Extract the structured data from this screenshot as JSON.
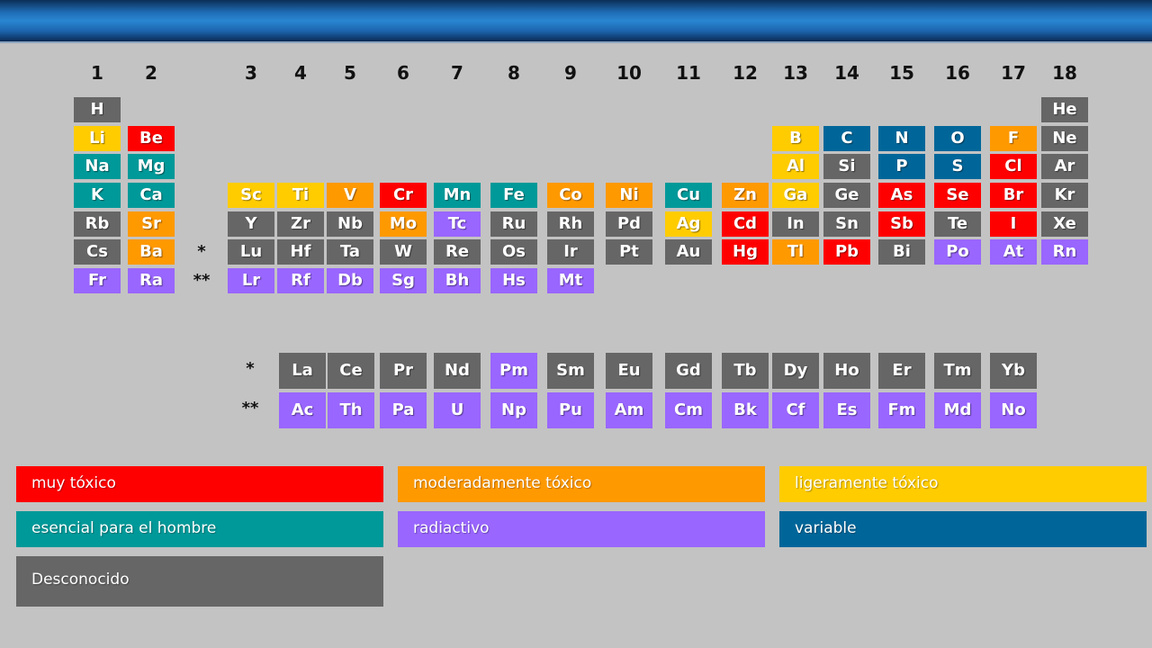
{
  "colors": {
    "very_toxic": "#ff0000",
    "moderately_toxic": "#ff9900",
    "slightly_toxic": "#ffcc00",
    "essential": "#009999",
    "radioactive": "#9966ff",
    "variable": "#006699",
    "unknown": "#666666"
  },
  "groups": [
    "1",
    "2",
    "3",
    "4",
    "5",
    "6",
    "7",
    "8",
    "9",
    "10",
    "11",
    "12",
    "13",
    "14",
    "15",
    "16",
    "17",
    "18"
  ],
  "markers": {
    "lanthanide": "*",
    "actinide": "**"
  },
  "elements": [
    {
      "symbol": "H",
      "cat": "unknown",
      "group": 1,
      "period": 1
    },
    {
      "symbol": "He",
      "cat": "unknown",
      "group": 18,
      "period": 1
    },
    {
      "symbol": "Li",
      "cat": "slightly_toxic",
      "group": 1,
      "period": 2
    },
    {
      "symbol": "Be",
      "cat": "very_toxic",
      "group": 2,
      "period": 2
    },
    {
      "symbol": "B",
      "cat": "slightly_toxic",
      "group": 13,
      "period": 2
    },
    {
      "symbol": "C",
      "cat": "variable",
      "group": 14,
      "period": 2
    },
    {
      "symbol": "N",
      "cat": "variable",
      "group": 15,
      "period": 2
    },
    {
      "symbol": "O",
      "cat": "variable",
      "group": 16,
      "period": 2
    },
    {
      "symbol": "F",
      "cat": "moderately_toxic",
      "group": 17,
      "period": 2
    },
    {
      "symbol": "Ne",
      "cat": "unknown",
      "group": 18,
      "period": 2
    },
    {
      "symbol": "Na",
      "cat": "essential",
      "group": 1,
      "period": 3
    },
    {
      "symbol": "Mg",
      "cat": "essential",
      "group": 2,
      "period": 3
    },
    {
      "symbol": "Al",
      "cat": "slightly_toxic",
      "group": 13,
      "period": 3
    },
    {
      "symbol": "Si",
      "cat": "unknown",
      "group": 14,
      "period": 3
    },
    {
      "symbol": "P",
      "cat": "variable",
      "group": 15,
      "period": 3
    },
    {
      "symbol": "S",
      "cat": "variable",
      "group": 16,
      "period": 3
    },
    {
      "symbol": "Cl",
      "cat": "very_toxic",
      "group": 17,
      "period": 3
    },
    {
      "symbol": "Ar",
      "cat": "unknown",
      "group": 18,
      "period": 3
    },
    {
      "symbol": "K",
      "cat": "essential",
      "group": 1,
      "period": 4
    },
    {
      "symbol": "Ca",
      "cat": "essential",
      "group": 2,
      "period": 4
    },
    {
      "symbol": "Sc",
      "cat": "slightly_toxic",
      "group": 3,
      "period": 4
    },
    {
      "symbol": "Ti",
      "cat": "slightly_toxic",
      "group": 4,
      "period": 4
    },
    {
      "symbol": "V",
      "cat": "moderately_toxic",
      "group": 5,
      "period": 4
    },
    {
      "symbol": "Cr",
      "cat": "very_toxic",
      "group": 6,
      "period": 4
    },
    {
      "symbol": "Mn",
      "cat": "essential",
      "group": 7,
      "period": 4
    },
    {
      "symbol": "Fe",
      "cat": "essential",
      "group": 8,
      "period": 4
    },
    {
      "symbol": "Co",
      "cat": "moderately_toxic",
      "group": 9,
      "period": 4
    },
    {
      "symbol": "Ni",
      "cat": "moderately_toxic",
      "group": 10,
      "period": 4
    },
    {
      "symbol": "Cu",
      "cat": "essential",
      "group": 11,
      "period": 4
    },
    {
      "symbol": "Zn",
      "cat": "moderately_toxic",
      "group": 12,
      "period": 4
    },
    {
      "symbol": "Ga",
      "cat": "slightly_toxic",
      "group": 13,
      "period": 4
    },
    {
      "symbol": "Ge",
      "cat": "unknown",
      "group": 14,
      "period": 4
    },
    {
      "symbol": "As",
      "cat": "very_toxic",
      "group": 15,
      "period": 4
    },
    {
      "symbol": "Se",
      "cat": "very_toxic",
      "group": 16,
      "period": 4
    },
    {
      "symbol": "Br",
      "cat": "very_toxic",
      "group": 17,
      "period": 4
    },
    {
      "symbol": "Kr",
      "cat": "unknown",
      "group": 18,
      "period": 4
    },
    {
      "symbol": "Rb",
      "cat": "unknown",
      "group": 1,
      "period": 5
    },
    {
      "symbol": "Sr",
      "cat": "moderately_toxic",
      "group": 2,
      "period": 5
    },
    {
      "symbol": "Y",
      "cat": "unknown",
      "group": 3,
      "period": 5
    },
    {
      "symbol": "Zr",
      "cat": "unknown",
      "group": 4,
      "period": 5
    },
    {
      "symbol": "Nb",
      "cat": "unknown",
      "group": 5,
      "period": 5
    },
    {
      "symbol": "Mo",
      "cat": "moderately_toxic",
      "group": 6,
      "period": 5
    },
    {
      "symbol": "Tc",
      "cat": "radioactive",
      "group": 7,
      "period": 5
    },
    {
      "symbol": "Ru",
      "cat": "unknown",
      "group": 8,
      "period": 5
    },
    {
      "symbol": "Rh",
      "cat": "unknown",
      "group": 9,
      "period": 5
    },
    {
      "symbol": "Pd",
      "cat": "unknown",
      "group": 10,
      "period": 5
    },
    {
      "symbol": "Ag",
      "cat": "slightly_toxic",
      "group": 11,
      "period": 5
    },
    {
      "symbol": "Cd",
      "cat": "very_toxic",
      "group": 12,
      "period": 5
    },
    {
      "symbol": "In",
      "cat": "unknown",
      "group": 13,
      "period": 5
    },
    {
      "symbol": "Sn",
      "cat": "unknown",
      "group": 14,
      "period": 5
    },
    {
      "symbol": "Sb",
      "cat": "very_toxic",
      "group": 15,
      "period": 5
    },
    {
      "symbol": "Te",
      "cat": "unknown",
      "group": 16,
      "period": 5
    },
    {
      "symbol": "I",
      "cat": "very_toxic",
      "group": 17,
      "period": 5
    },
    {
      "symbol": "Xe",
      "cat": "unknown",
      "group": 18,
      "period": 5
    },
    {
      "symbol": "Cs",
      "cat": "unknown",
      "group": 1,
      "period": 6
    },
    {
      "symbol": "Ba",
      "cat": "moderately_toxic",
      "group": 2,
      "period": 6
    },
    {
      "symbol": "Lu",
      "cat": "unknown",
      "group": 3,
      "period": 6
    },
    {
      "symbol": "Hf",
      "cat": "unknown",
      "group": 4,
      "period": 6
    },
    {
      "symbol": "Ta",
      "cat": "unknown",
      "group": 5,
      "period": 6
    },
    {
      "symbol": "W",
      "cat": "unknown",
      "group": 6,
      "period": 6
    },
    {
      "symbol": "Re",
      "cat": "unknown",
      "group": 7,
      "period": 6
    },
    {
      "symbol": "Os",
      "cat": "unknown",
      "group": 8,
      "period": 6
    },
    {
      "symbol": "Ir",
      "cat": "unknown",
      "group": 9,
      "period": 6
    },
    {
      "symbol": "Pt",
      "cat": "unknown",
      "group": 10,
      "period": 6
    },
    {
      "symbol": "Au",
      "cat": "unknown",
      "group": 11,
      "period": 6
    },
    {
      "symbol": "Hg",
      "cat": "very_toxic",
      "group": 12,
      "period": 6
    },
    {
      "symbol": "Tl",
      "cat": "moderately_toxic",
      "group": 13,
      "period": 6
    },
    {
      "symbol": "Pb",
      "cat": "very_toxic",
      "group": 14,
      "period": 6
    },
    {
      "symbol": "Bi",
      "cat": "unknown",
      "group": 15,
      "period": 6
    },
    {
      "symbol": "Po",
      "cat": "radioactive",
      "group": 16,
      "period": 6
    },
    {
      "symbol": "At",
      "cat": "radioactive",
      "group": 17,
      "period": 6
    },
    {
      "symbol": "Rn",
      "cat": "radioactive",
      "group": 18,
      "period": 6
    },
    {
      "symbol": "Fr",
      "cat": "radioactive",
      "group": 1,
      "period": 7
    },
    {
      "symbol": "Ra",
      "cat": "radioactive",
      "group": 2,
      "period": 7
    },
    {
      "symbol": "Lr",
      "cat": "radioactive",
      "group": 3,
      "period": 7
    },
    {
      "symbol": "Rf",
      "cat": "radioactive",
      "group": 4,
      "period": 7
    },
    {
      "symbol": "Db",
      "cat": "radioactive",
      "group": 5,
      "period": 7
    },
    {
      "symbol": "Sg",
      "cat": "radioactive",
      "group": 6,
      "period": 7
    },
    {
      "symbol": "Bh",
      "cat": "radioactive",
      "group": 7,
      "period": 7
    },
    {
      "symbol": "Hs",
      "cat": "radioactive",
      "group": 8,
      "period": 7
    },
    {
      "symbol": "Mt",
      "cat": "radioactive",
      "group": 9,
      "period": 7
    }
  ],
  "lanthanides": [
    {
      "symbol": "La",
      "cat": "unknown"
    },
    {
      "symbol": "Ce",
      "cat": "unknown"
    },
    {
      "symbol": "Pr",
      "cat": "unknown"
    },
    {
      "symbol": "Nd",
      "cat": "unknown"
    },
    {
      "symbol": "Pm",
      "cat": "radioactive"
    },
    {
      "symbol": "Sm",
      "cat": "unknown"
    },
    {
      "symbol": "Eu",
      "cat": "unknown"
    },
    {
      "symbol": "Gd",
      "cat": "unknown"
    },
    {
      "symbol": "Tb",
      "cat": "unknown"
    },
    {
      "symbol": "Dy",
      "cat": "unknown"
    },
    {
      "symbol": "Ho",
      "cat": "unknown"
    },
    {
      "symbol": "Er",
      "cat": "unknown"
    },
    {
      "symbol": "Tm",
      "cat": "unknown"
    },
    {
      "symbol": "Yb",
      "cat": "unknown"
    }
  ],
  "actinides": [
    {
      "symbol": "Ac",
      "cat": "radioactive"
    },
    {
      "symbol": "Th",
      "cat": "radioactive"
    },
    {
      "symbol": "Pa",
      "cat": "radioactive"
    },
    {
      "symbol": "U",
      "cat": "radioactive"
    },
    {
      "symbol": "Np",
      "cat": "radioactive"
    },
    {
      "symbol": "Pu",
      "cat": "radioactive"
    },
    {
      "symbol": "Am",
      "cat": "radioactive"
    },
    {
      "symbol": "Cm",
      "cat": "radioactive"
    },
    {
      "symbol": "Bk",
      "cat": "radioactive"
    },
    {
      "symbol": "Cf",
      "cat": "radioactive"
    },
    {
      "symbol": "Es",
      "cat": "radioactive"
    },
    {
      "symbol": "Fm",
      "cat": "radioactive"
    },
    {
      "symbol": "Md",
      "cat": "radioactive"
    },
    {
      "symbol": "No",
      "cat": "radioactive"
    }
  ],
  "legend": [
    {
      "label": "muy tóxico",
      "cat": "very_toxic"
    },
    {
      "label": "moderadamente tóxico",
      "cat": "moderately_toxic"
    },
    {
      "label": "ligeramente tóxico",
      "cat": "slightly_toxic"
    },
    {
      "label": "esencial para el hombre",
      "cat": "essential"
    },
    {
      "label": "radiactivo",
      "cat": "radioactive"
    },
    {
      "label": "variable",
      "cat": "variable"
    },
    {
      "label": "Desconocido",
      "cat": "unknown"
    }
  ]
}
